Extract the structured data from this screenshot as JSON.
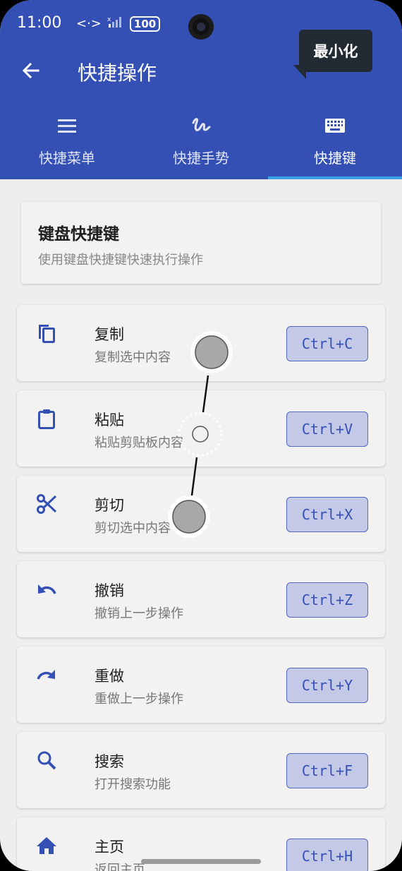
{
  "status": {
    "time": "11:00",
    "battery": "100"
  },
  "appbar": {
    "title": "快捷操作",
    "tooltip": "最小化"
  },
  "tabs": [
    {
      "label": "快捷菜单"
    },
    {
      "label": "快捷手势"
    },
    {
      "label": "快捷键"
    }
  ],
  "header": {
    "title": "键盘快捷键",
    "subtitle": "使用键盘快捷键快速执行操作"
  },
  "shortcuts": [
    {
      "name": "复制",
      "desc": "复制选中内容",
      "key": "Ctrl+C"
    },
    {
      "name": "粘贴",
      "desc": "粘贴剪贴板内容",
      "key": "Ctrl+V"
    },
    {
      "name": "剪切",
      "desc": "剪切选中内容",
      "key": "Ctrl+X"
    },
    {
      "name": "撤销",
      "desc": "撤销上一步操作",
      "key": "Ctrl+Z"
    },
    {
      "name": "重做",
      "desc": "重做上一步操作",
      "key": "Ctrl+Y"
    },
    {
      "name": "搜索",
      "desc": "打开搜索功能",
      "key": "Ctrl+F"
    },
    {
      "name": "主页",
      "desc": "返回主页",
      "key": "Ctrl+H"
    }
  ],
  "colors": {
    "primary": "#3550b5",
    "indicator": "#3aa0e8",
    "key_bg": "#c3c9e6"
  }
}
